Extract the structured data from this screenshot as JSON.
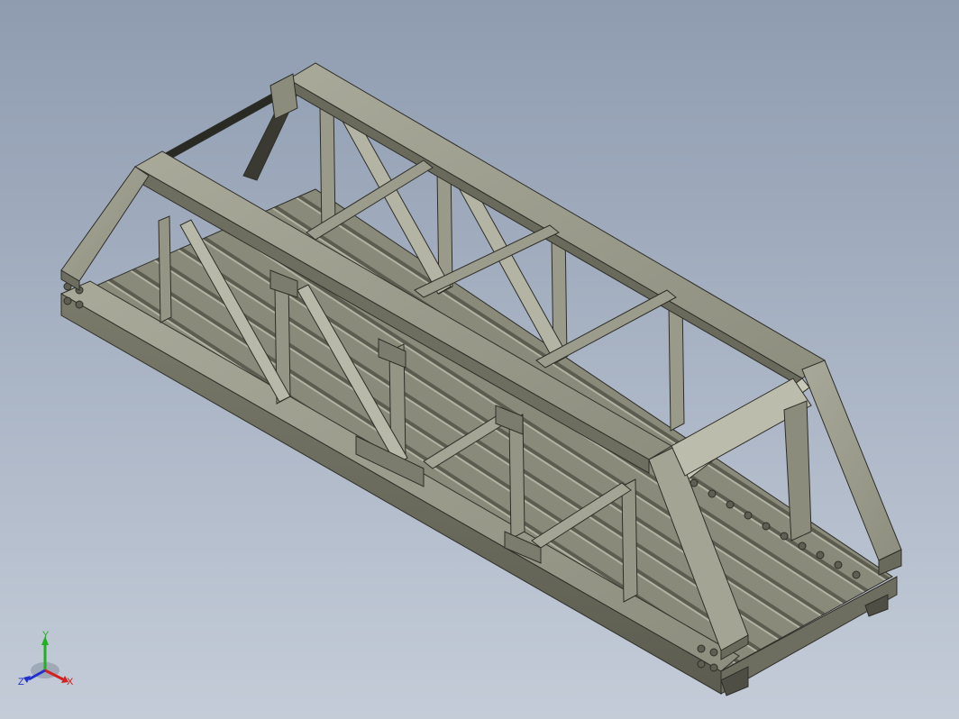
{
  "viewport": {
    "background_top": "#8f9cb0",
    "background_bottom": "#c4ccd8"
  },
  "model": {
    "description_icon": "truss-bridge-model",
    "body_color": "#8c8c7c",
    "face_light": "#a8a898",
    "face_dark": "#5f5f52",
    "edge_color": "#2e2e28"
  },
  "triad": {
    "x_label": "X",
    "y_label": "Y",
    "z_label": "Z",
    "x_color": "#d42020",
    "y_color": "#20b020",
    "z_color": "#2030d0"
  }
}
